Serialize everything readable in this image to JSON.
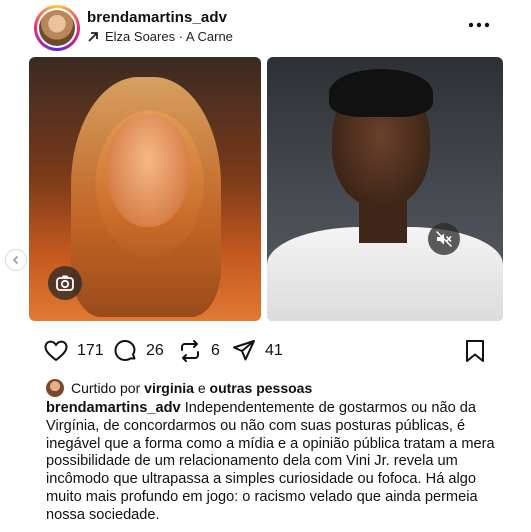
{
  "post": {
    "username": "brendamartins_adv",
    "audio": "Elza Soares · A Carne"
  },
  "icons": {
    "more": "more-options-icon",
    "audio_arrow": "arrow-up-right-icon",
    "camera": "camera-icon",
    "mute": "speaker-muted-icon",
    "prev": "chevron-left-icon",
    "like": "heart-icon",
    "comment": "comment-icon",
    "repost": "repost-icon",
    "share": "send-icon",
    "save": "bookmark-icon"
  },
  "actions": {
    "likes": "171",
    "comments": "26",
    "reposts": "6",
    "shares": "41"
  },
  "liked_by": {
    "prefix": "Curtido por",
    "user": "virginia",
    "conjunction": "e",
    "others": "outras pessoas"
  },
  "caption": {
    "username": "brendamartins_adv",
    "text": "Independentemente de gostarmos ou não da Virgínia, de concordarmos ou não com suas posturas públicas, é inegável que a forma como a mídia e a opinião pública tratam a mera possibilidade de um relacionamento dela com Vini Jr. revela um incômodo que ultrapassa a simples curiosidade ou fofoca. Há algo muito mais profundo em jogo: o racismo velado que ainda permeia nossa sociedade."
  },
  "colors": {
    "ring_gradient": [
      "#f9ce34",
      "#ee2a7b",
      "#6228d7"
    ],
    "text": "#111111",
    "background": "#ffffff"
  }
}
